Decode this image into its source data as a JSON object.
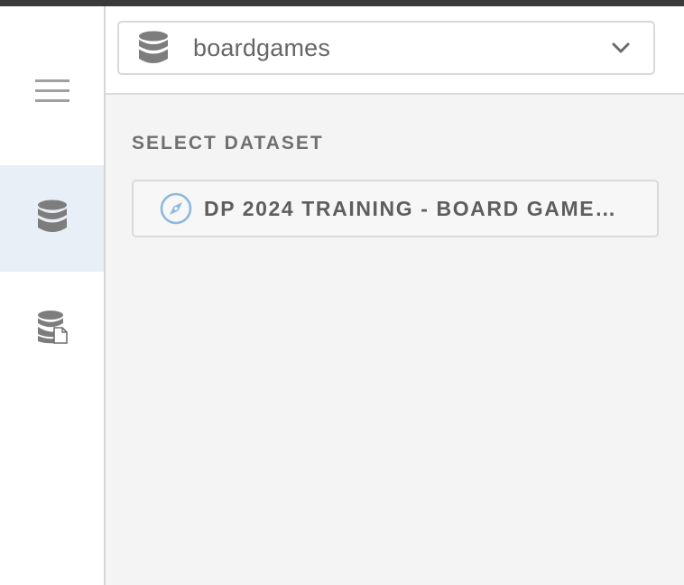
{
  "header": {
    "dataset_select": {
      "value": "boardgames",
      "icon": "database-icon"
    }
  },
  "sidebar": {
    "items": [
      {
        "icon": "hamburger-menu-icon",
        "active": false
      },
      {
        "icon": "database-icon",
        "active": true
      },
      {
        "icon": "database-file-icon",
        "active": false
      }
    ]
  },
  "main": {
    "section_title": "SELECT DATASET",
    "datasets": [
      {
        "label": "DP 2024 TRAINING - BOARD GAMES ...",
        "icon": "compass-icon"
      }
    ]
  },
  "colors": {
    "top_strip": "#3a3a3a",
    "active_sidebar_bg": "#e9eff6",
    "panel_bg": "#f4f4f4",
    "compass_accent": "#8db9df"
  }
}
